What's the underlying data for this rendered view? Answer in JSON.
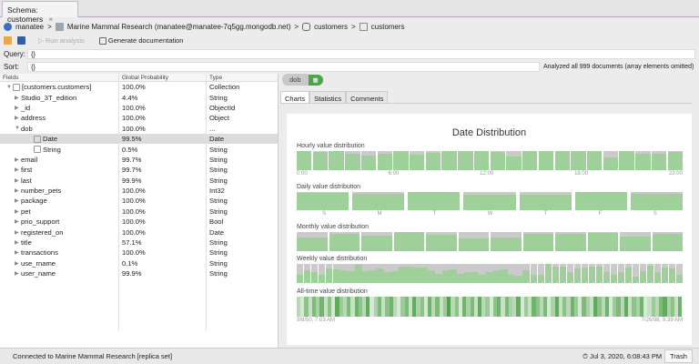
{
  "tab": {
    "title": "Schema: customers",
    "close": "×"
  },
  "breadcrumb": [
    "manatee",
    "Marine Mammal Research (manatee@manatee-7q5gg.mongodb.net)",
    "customers",
    "customers"
  ],
  "toolbar": {
    "run": "Run analysis",
    "generate": "Generate documentation"
  },
  "query": {
    "label": "Query:",
    "value": "{}"
  },
  "sort": {
    "label": "Sort:",
    "value": "{}"
  },
  "analyzed": "Analyzed all 999 documents (array elements omitted)",
  "fields": {
    "headers": [
      "Fields",
      "Global Probability",
      "Type"
    ],
    "rows": [
      {
        "name": "[customers.customers]",
        "prob": "100.0%",
        "type": "Collection",
        "lvl": 0,
        "exp": "open",
        "icon": "collection"
      },
      {
        "name": "Studio_3T_edition",
        "prob": "4.4%",
        "type": "String",
        "lvl": 1,
        "exp": "closed"
      },
      {
        "name": "_id",
        "prob": "100.0%",
        "type": "ObjectId",
        "lvl": 1,
        "exp": "closed"
      },
      {
        "name": "address",
        "prob": "100.0%",
        "type": "Object",
        "lvl": 1,
        "exp": "closed"
      },
      {
        "name": "dob",
        "prob": "100.0%",
        "type": "...",
        "lvl": 1,
        "exp": "open"
      },
      {
        "name": "Date",
        "prob": "99.5%",
        "type": "Date",
        "lvl": 2,
        "exp": "",
        "icon": "date",
        "sel": true
      },
      {
        "name": "String",
        "prob": "0.5%",
        "type": "String",
        "lvl": 2,
        "exp": "",
        "icon": "string"
      },
      {
        "name": "email",
        "prob": "99.7%",
        "type": "String",
        "lvl": 1,
        "exp": "closed"
      },
      {
        "name": "first",
        "prob": "99.7%",
        "type": "String",
        "lvl": 1,
        "exp": "closed"
      },
      {
        "name": "last",
        "prob": "99.9%",
        "type": "String",
        "lvl": 1,
        "exp": "closed"
      },
      {
        "name": "number_pets",
        "prob": "100.0%",
        "type": "Int32",
        "lvl": 1,
        "exp": "closed"
      },
      {
        "name": "package",
        "prob": "100.0%",
        "type": "String",
        "lvl": 1,
        "exp": "closed"
      },
      {
        "name": "pet",
        "prob": "100.0%",
        "type": "String",
        "lvl": 1,
        "exp": "closed"
      },
      {
        "name": "prio_support",
        "prob": "100.0%",
        "type": "Bool",
        "lvl": 1,
        "exp": "closed"
      },
      {
        "name": "registered_on",
        "prob": "100.0%",
        "type": "Date",
        "lvl": 1,
        "exp": "closed"
      },
      {
        "name": "title",
        "prob": "57.1%",
        "type": "String",
        "lvl": 1,
        "exp": "closed"
      },
      {
        "name": "transactions",
        "prob": "100.0%",
        "type": "String",
        "lvl": 1,
        "exp": "closed"
      },
      {
        "name": "use_rname",
        "prob": "0.1%",
        "type": "String",
        "lvl": 1,
        "exp": "closed"
      },
      {
        "name": "user_name",
        "prob": "99.9%",
        "type": "String",
        "lvl": 1,
        "exp": "closed"
      }
    ]
  },
  "path": {
    "field": "dob",
    "type_badge": "▦"
  },
  "subtabs": [
    "Charts",
    "Statistics",
    "Comments"
  ],
  "chart_data": {
    "type": "bar",
    "title": "Date Distribution",
    "colors": {
      "fill": "#9fd09a",
      "empty": "#cacaca",
      "stripe": "#4a9e44"
    },
    "sections": [
      {
        "label": "Hourly value distribution",
        "ticks": [
          "0:00",
          "6:00",
          "12:00",
          "18:00",
          "23:00"
        ],
        "values": [
          1,
          0.95,
          1,
          0.85,
          0.75,
          0.85,
          1,
          0.8,
          0.9,
          1,
          1,
          1,
          0.95,
          0.7,
          1,
          1,
          1,
          1,
          1,
          0.65,
          1,
          0.85,
          0.85,
          0.95
        ]
      },
      {
        "label": "Daily value distribution",
        "ticks": [
          "S",
          "M",
          "T",
          "W",
          "T",
          "F",
          "S"
        ],
        "values": [
          0.95,
          0.9,
          1,
          0.85,
          0.85,
          1,
          0.9
        ]
      },
      {
        "label": "Monthly value distribution",
        "ticks": [],
        "values": [
          0.7,
          0.9,
          0.8,
          1,
          0.85,
          0.65,
          0.7,
          0.9,
          0.9,
          0.95,
          0.75,
          0.9
        ]
      },
      {
        "label": "Weekly value distribution",
        "ticks": [],
        "values": [
          0.45,
          0.65,
          0.55,
          0.45,
          0.75,
          0.7,
          0.65,
          0.6,
          0.95,
          0.6,
          0.65,
          0.75,
          0.55,
          0.6,
          0.85,
          0.85,
          0.8,
          0.8,
          0.65,
          0.5,
          0.65,
          0.7,
          0.5,
          0.55,
          0.55,
          0.45,
          0.55,
          0.65,
          0.7,
          0.45,
          0.4,
          0.65,
          0.45,
          0.45,
          1,
          0.85,
          0.85,
          0.55,
          0.75,
          0.8,
          0.85,
          0.85,
          0.55,
          0.45,
          0.55,
          0.8,
          0.35,
          0.6,
          0.9,
          0.55,
          0.8,
          0.75,
          0.45
        ]
      },
      {
        "label": "All-time value distribution",
        "ticks": [
          "9/8/50, 7:03 AM",
          "7/26/98, 9:39 AM"
        ],
        "values": [
          0.3,
          0.1,
          0.6,
          0.2,
          0.7,
          0.4,
          0.8,
          0.2,
          0.6,
          0.1,
          0.9,
          0.5,
          0.3,
          0.7,
          0.2,
          0.8,
          0.6,
          0.3,
          0.9,
          0.1,
          0.4,
          0.7,
          0.2,
          0.6,
          0.8,
          0.3,
          0.1,
          0.5,
          0.7,
          0.2,
          0.9,
          0.4,
          0.6,
          0.1,
          0.8,
          0.3,
          0.7,
          0.2,
          0.5,
          1,
          0.3,
          0.6,
          0.1,
          0.8,
          0.4,
          0.7,
          0.2,
          0.9,
          0.3,
          0.5,
          0.1,
          0.6,
          0.8,
          0.2,
          0.7,
          0.4,
          0.3,
          0.9,
          0.1,
          0.5,
          0.2,
          0.8,
          0.6,
          0.3,
          0.7,
          0.1,
          0.4,
          0.9,
          0.2,
          0.6,
          0.3,
          0.8,
          0.5,
          0.1,
          0.7,
          0.4,
          0.2,
          0.9,
          0.6,
          0.3,
          0.8,
          0.1,
          0.5,
          0.7,
          0.3,
          0.9,
          0.2,
          0.6,
          0.4,
          0.8,
          0.1,
          0.2,
          0.5,
          0.3,
          0.7,
          0.9,
          0.4,
          0.6,
          0.2,
          0.8
        ]
      }
    ]
  },
  "status": {
    "connection": "Connected to Marine Mammal Research [replica set]",
    "time": "Jul 3, 2020, 6:08:43 PM",
    "tooltip": "Trash"
  }
}
